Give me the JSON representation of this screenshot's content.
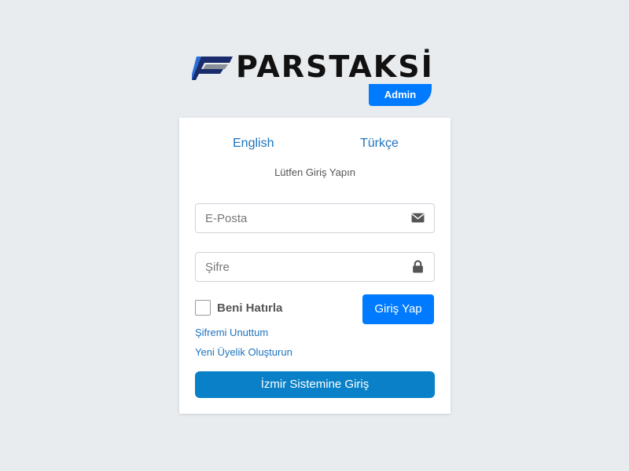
{
  "brand": {
    "name": "PARSTAKSİ",
    "badge": "Admin",
    "primary_color": "#007bff",
    "logo_dark": "#1a2b6b",
    "logo_gray": "#8a8f99"
  },
  "login": {
    "languages": [
      "English",
      "Türkçe"
    ],
    "subtitle": "Lütfen Giriş Yapın",
    "email": {
      "placeholder": "E-Posta",
      "value": "",
      "icon": "envelope-icon"
    },
    "password": {
      "placeholder": "Şifre",
      "value": "",
      "icon": "lock-icon"
    },
    "remember_label": "Beni Hatırla",
    "login_button": "Giriş Yap",
    "forgot_link": "Şifremi Unuttum",
    "register_link": "Yeni Üyelik Oluşturun",
    "izmir_button": "İzmir Sistemine Giriş"
  }
}
